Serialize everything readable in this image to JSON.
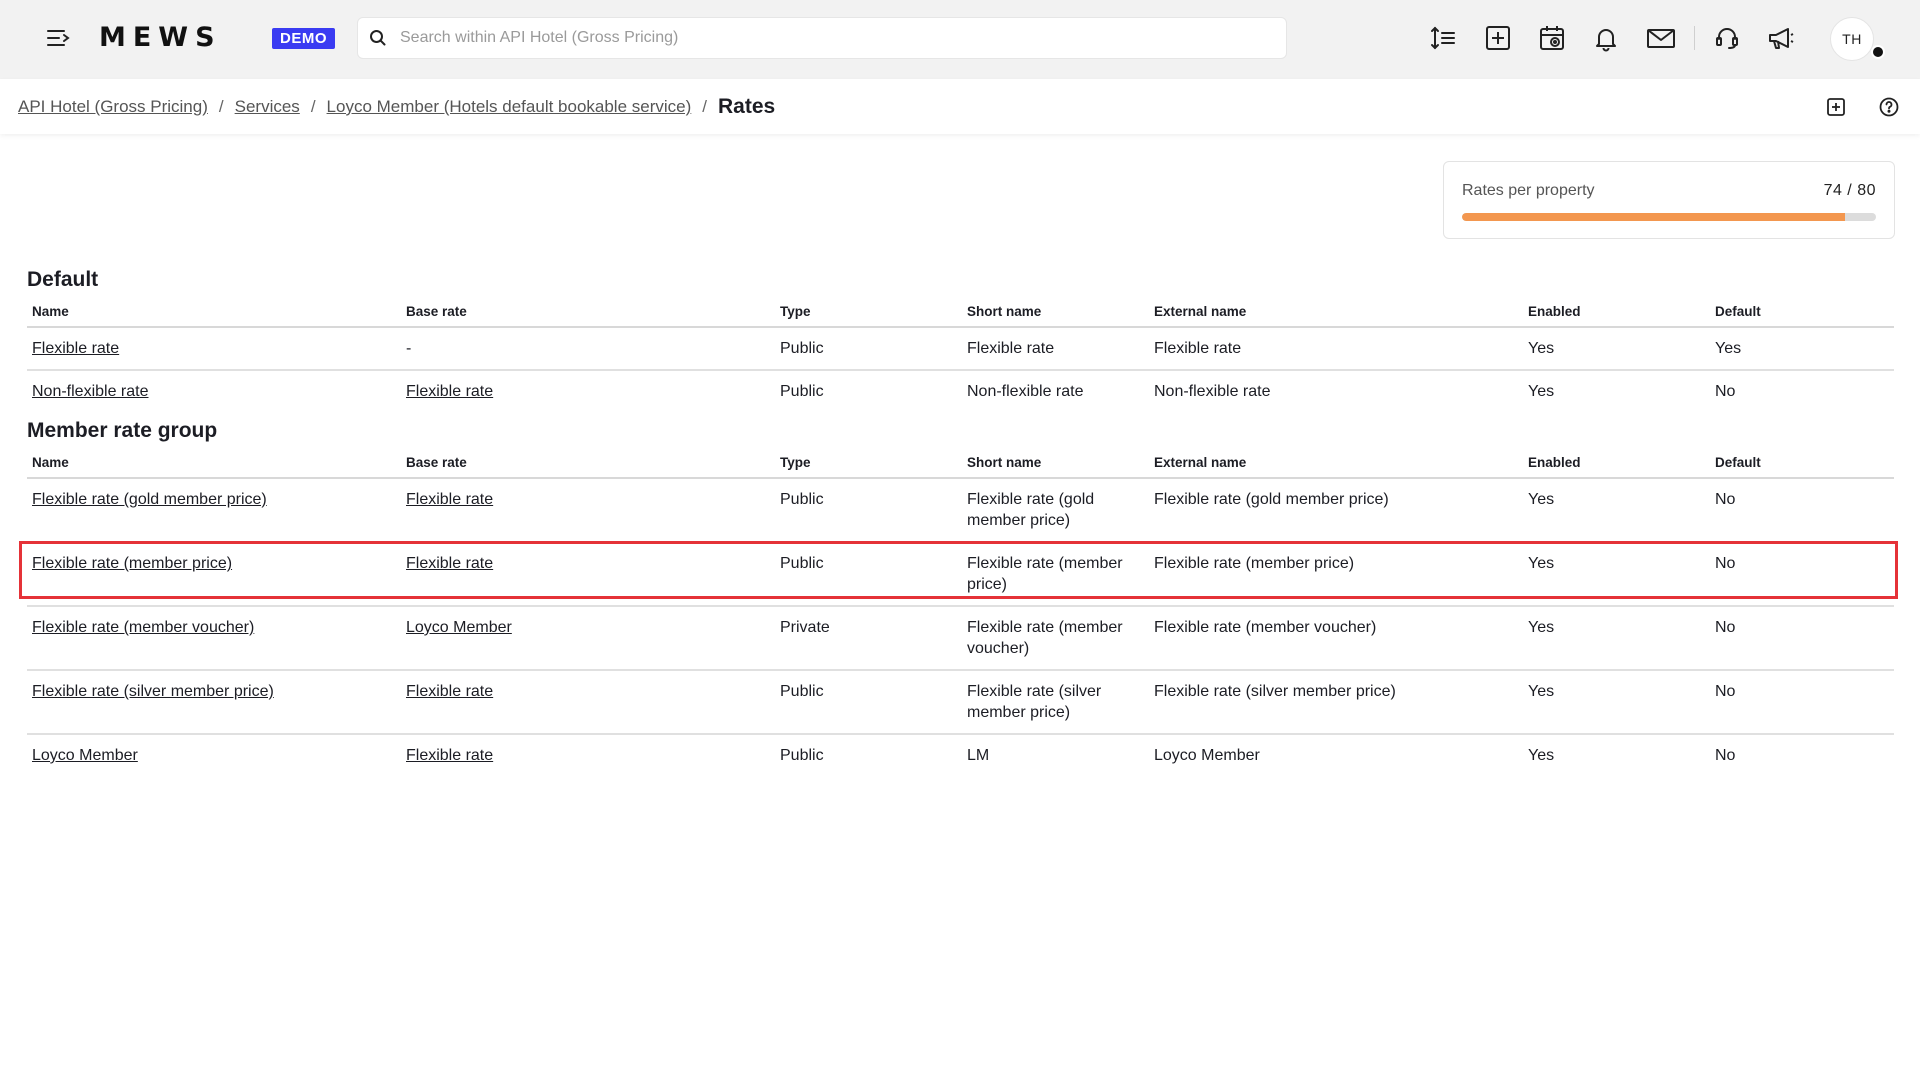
{
  "topbar": {
    "logo": "MEWS",
    "badge": "DEMO",
    "search_placeholder": "Search within API Hotel (Gross Pricing)",
    "icons": [
      "menu-collapse-icon",
      "sort-lines-icon",
      "add-square-icon",
      "calendar-view-icon",
      "bell-icon",
      "mail-icon",
      "support-headset-icon",
      "megaphone-icon"
    ],
    "avatar_initials": "TH"
  },
  "breadcrumb": {
    "items": [
      "API Hotel (Gross Pricing)",
      "Services",
      "Loyco Member (Hotels default bookable service)"
    ],
    "separator": "/",
    "current": "Rates"
  },
  "counter": {
    "label": "Rates per property",
    "value_text": "74 / 80",
    "used": 74,
    "max": 80,
    "fill_color": "#f3974f"
  },
  "columns": [
    "Name",
    "Base rate",
    "Type",
    "Short name",
    "External name",
    "Enabled",
    "Default"
  ],
  "groups": [
    {
      "title": "Default",
      "rows": [
        {
          "name": "Flexible rate",
          "base_rate": "-",
          "base_rate_link": false,
          "type": "Public",
          "short_name": "Flexible rate",
          "external_name": "Flexible rate",
          "enabled": "Yes",
          "default": "Yes"
        },
        {
          "name": "Non-flexible rate",
          "base_rate": "Flexible rate",
          "base_rate_link": true,
          "type": "Public",
          "short_name": "Non-flexible rate",
          "external_name": "Non-flexible rate",
          "enabled": "Yes",
          "default": "No"
        }
      ]
    },
    {
      "title": "Member rate group",
      "rows": [
        {
          "name": "Flexible rate (gold member price)",
          "base_rate": "Flexible rate",
          "base_rate_link": true,
          "type": "Public",
          "short_name": "Flexible rate (gold member price)",
          "external_name": "Flexible rate (gold member price)",
          "enabled": "Yes",
          "default": "No"
        },
        {
          "name": "Flexible rate (member price)",
          "base_rate": "Flexible rate",
          "base_rate_link": true,
          "type": "Public",
          "short_name": "Flexible rate (member price)",
          "external_name": "Flexible rate (member price)",
          "enabled": "Yes",
          "default": "No"
        },
        {
          "name": "Flexible rate (member voucher)",
          "base_rate": "Loyco Member",
          "base_rate_link": true,
          "type": "Private",
          "short_name": "Flexible rate (member voucher)",
          "external_name": "Flexible rate (member voucher)",
          "enabled": "Yes",
          "default": "No"
        },
        {
          "name": "Flexible rate (silver member price)",
          "base_rate": "Flexible rate",
          "base_rate_link": true,
          "type": "Public",
          "short_name": "Flexible rate (silver member price)",
          "external_name": "Flexible rate (silver member price)",
          "enabled": "Yes",
          "default": "No"
        },
        {
          "name": "Loyco Member",
          "base_rate": "Flexible rate",
          "base_rate_link": true,
          "type": "Public",
          "short_name": "LM",
          "external_name": "Loyco Member",
          "enabled": "Yes",
          "default": "No"
        }
      ]
    }
  ],
  "highlight": {
    "group": 1,
    "row": 1,
    "color": "#e53238"
  }
}
